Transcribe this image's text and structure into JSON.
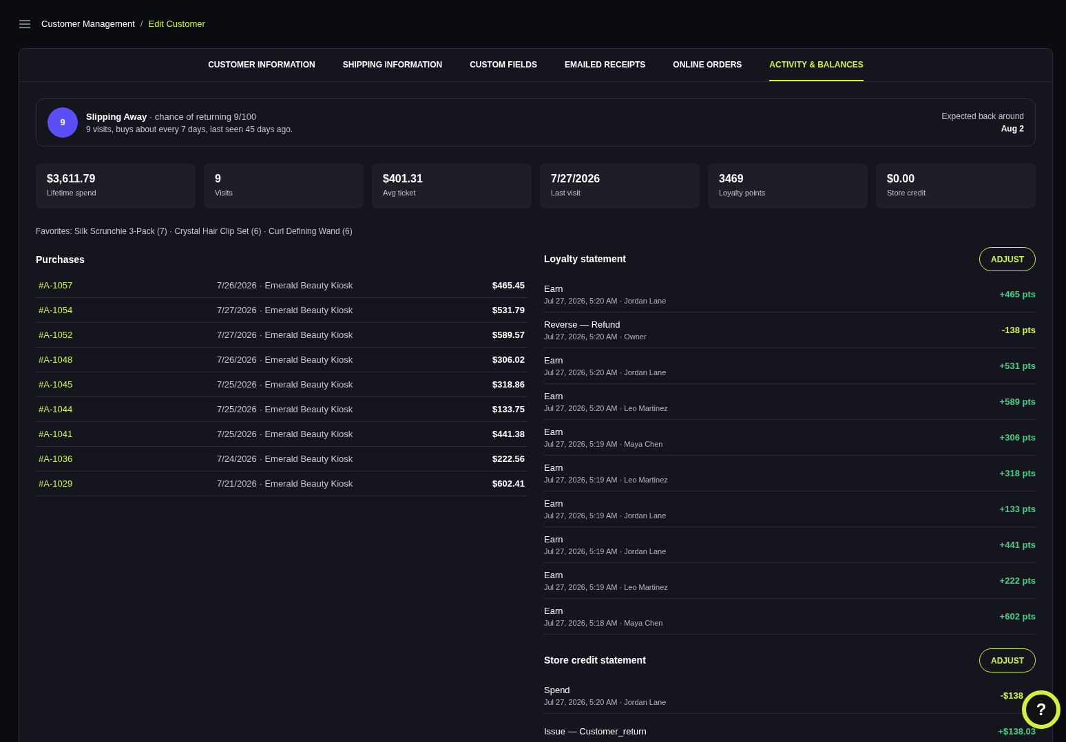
{
  "breadcrumb": {
    "parent": "Customer Management",
    "separator": "/",
    "current": "Edit Customer"
  },
  "tabs": [
    {
      "label": "CUSTOMER INFORMATION",
      "selected": false
    },
    {
      "label": "SHIPPING INFORMATION",
      "selected": false
    },
    {
      "label": "CUSTOM FIELDS",
      "selected": false
    },
    {
      "label": "EMAILED RECEIPTS",
      "selected": false
    },
    {
      "label": "ONLINE ORDERS",
      "selected": false
    },
    {
      "label": "ACTIVITY & BALANCES",
      "selected": true
    }
  ],
  "retention": {
    "score": "9",
    "status": "Slipping Away",
    "chance": "· chance of returning 9/100",
    "detail": "9 visits, buys about every 7 days, last seen 45 days ago.",
    "expected_label": "Expected back around",
    "expected_date": "Aug 2"
  },
  "stats": [
    {
      "value": "$3,611.79",
      "label": "Lifetime spend"
    },
    {
      "value": "9",
      "label": "Visits"
    },
    {
      "value": "$401.31",
      "label": "Avg ticket"
    },
    {
      "value": "7/27/2026",
      "label": "Last visit"
    },
    {
      "value": "3469",
      "label": "Loyalty points"
    },
    {
      "value": "$0.00",
      "label": "Store credit"
    }
  ],
  "favorites": "Favorites: Silk Scrunchie 3-Pack (7) · Crystal Hair Clip Set (6) · Curl Defining Wand (6)",
  "purchases": {
    "title": "Purchases",
    "rows": [
      {
        "order": "#A-1057",
        "info": "7/26/2026 · Emerald Beauty Kiosk",
        "total": "$465.45"
      },
      {
        "order": "#A-1054",
        "info": "7/27/2026 · Emerald Beauty Kiosk",
        "total": "$531.79"
      },
      {
        "order": "#A-1052",
        "info": "7/27/2026 · Emerald Beauty Kiosk",
        "total": "$589.57"
      },
      {
        "order": "#A-1048",
        "info": "7/26/2026 · Emerald Beauty Kiosk",
        "total": "$306.02"
      },
      {
        "order": "#A-1045",
        "info": "7/25/2026 · Emerald Beauty Kiosk",
        "total": "$318.86"
      },
      {
        "order": "#A-1044",
        "info": "7/25/2026 · Emerald Beauty Kiosk",
        "total": "$133.75"
      },
      {
        "order": "#A-1041",
        "info": "7/25/2026 · Emerald Beauty Kiosk",
        "total": "$441.38"
      },
      {
        "order": "#A-1036",
        "info": "7/24/2026 · Emerald Beauty Kiosk",
        "total": "$222.56"
      },
      {
        "order": "#A-1029",
        "info": "7/21/2026 · Emerald Beauty Kiosk",
        "total": "$602.41"
      }
    ]
  },
  "statements": [
    {
      "title": "Loyalty statement",
      "button": "ADJUST",
      "entries": [
        {
          "type": "Earn",
          "meta": "Jul 27, 2026, 5:20 AM · Jordan Lane",
          "amount": "+465 pts",
          "negative": false
        },
        {
          "type": "Reverse — Refund",
          "meta": "Jul 27, 2026, 5:20 AM · Owner",
          "amount": "-138 pts",
          "negative": true
        },
        {
          "type": "Earn",
          "meta": "Jul 27, 2026, 5:20 AM · Jordan Lane",
          "amount": "+531 pts",
          "negative": false
        },
        {
          "type": "Earn",
          "meta": "Jul 27, 2026, 5:20 AM · Leo Martinez",
          "amount": "+589 pts",
          "negative": false
        },
        {
          "type": "Earn",
          "meta": "Jul 27, 2026, 5:19 AM · Maya Chen",
          "amount": "+306 pts",
          "negative": false
        },
        {
          "type": "Earn",
          "meta": "Jul 27, 2026, 5:19 AM · Leo Martinez",
          "amount": "+318 pts",
          "negative": false
        },
        {
          "type": "Earn",
          "meta": "Jul 27, 2026, 5:19 AM · Jordan Lane",
          "amount": "+133 pts",
          "negative": false
        },
        {
          "type": "Earn",
          "meta": "Jul 27, 2026, 5:19 AM · Jordan Lane",
          "amount": "+441 pts",
          "negative": false
        },
        {
          "type": "Earn",
          "meta": "Jul 27, 2026, 5:19 AM · Leo Martinez",
          "amount": "+222 pts",
          "negative": false
        },
        {
          "type": "Earn",
          "meta": "Jul 27, 2026, 5:18 AM · Maya Chen",
          "amount": "+602 pts",
          "negative": false
        }
      ]
    },
    {
      "title": "Store credit statement",
      "button": "ADJUST",
      "entries": [
        {
          "type": "Spend",
          "meta": "Jul 27, 2026, 5:20 AM · Jordan Lane",
          "amount": "-$138",
          "negative": true,
          "obscured": true
        },
        {
          "type": "Issue — Customer_return",
          "amount": "+$138.03",
          "negative": false,
          "obscured": false
        }
      ]
    }
  ],
  "help_button": {
    "label": "?"
  }
}
